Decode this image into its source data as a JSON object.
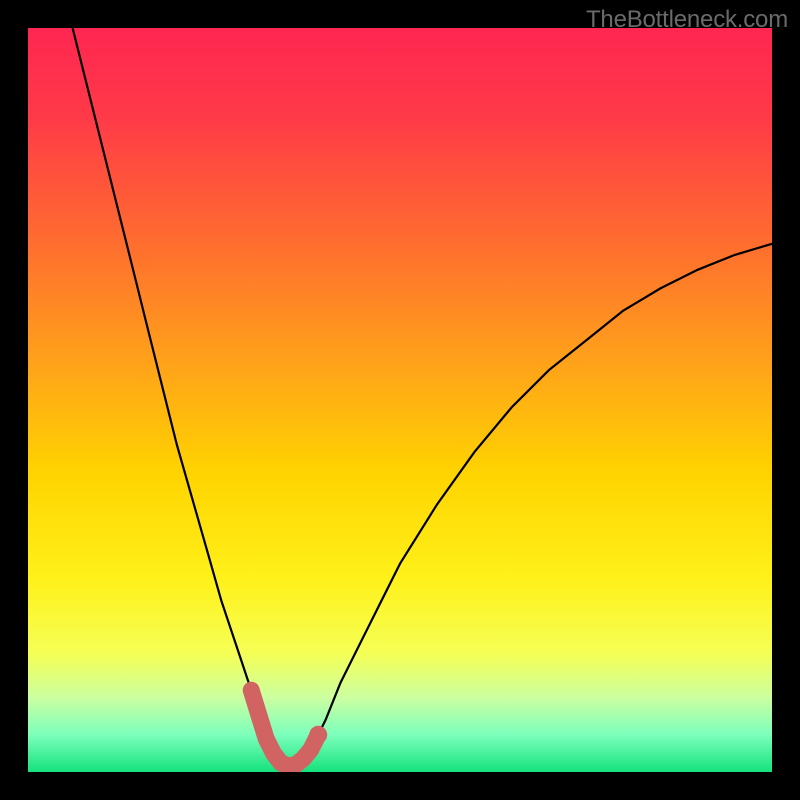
{
  "watermark": "TheBottleneck.com",
  "colors": {
    "frame": "#000000",
    "curve": "#000000",
    "marker": "#d16363",
    "gradientStops": [
      {
        "offset": 0.0,
        "color": "#ff2651"
      },
      {
        "offset": 0.12,
        "color": "#ff3a48"
      },
      {
        "offset": 0.28,
        "color": "#ff6a30"
      },
      {
        "offset": 0.45,
        "color": "#ffa21a"
      },
      {
        "offset": 0.6,
        "color": "#ffd400"
      },
      {
        "offset": 0.74,
        "color": "#fff11a"
      },
      {
        "offset": 0.84,
        "color": "#f5ff55"
      },
      {
        "offset": 0.9,
        "color": "#ccffa0"
      },
      {
        "offset": 0.95,
        "color": "#7cffbc"
      },
      {
        "offset": 1.0,
        "color": "#14e27c"
      }
    ]
  },
  "chart_data": {
    "type": "line",
    "title": "",
    "xlabel": "",
    "ylabel": "",
    "xlim": [
      0,
      100
    ],
    "ylim": [
      0,
      100
    ],
    "series": [
      {
        "name": "bottleneck-curve",
        "x": [
          6,
          8,
          10,
          12,
          14,
          16,
          18,
          20,
          22,
          24,
          26,
          28,
          30,
          32,
          33,
          34,
          35,
          36,
          38,
          40,
          42,
          46,
          50,
          55,
          60,
          65,
          70,
          75,
          80,
          85,
          90,
          95,
          100
        ],
        "y": [
          100,
          92,
          84,
          76,
          68,
          60,
          52,
          44,
          37,
          30,
          23,
          17,
          11,
          6,
          3,
          1,
          0.5,
          1,
          3,
          7,
          12,
          20,
          28,
          36,
          43,
          49,
          54,
          58,
          62,
          65,
          67.5,
          69.5,
          71
        ]
      }
    ],
    "highlight_region": {
      "name": "optimal-range",
      "x": [
        30,
        32,
        33,
        34,
        35,
        36,
        37,
        38,
        39
      ],
      "y": [
        11,
        4.5,
        2.5,
        1.2,
        0.8,
        1.0,
        1.8,
        3.0,
        5.0
      ]
    }
  }
}
